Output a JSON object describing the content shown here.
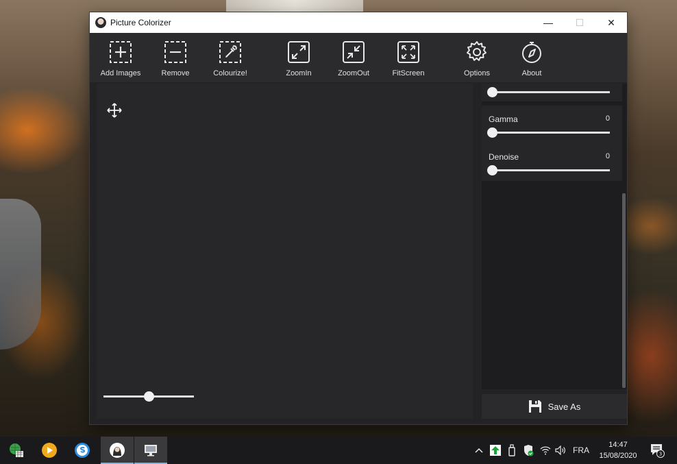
{
  "window": {
    "title": "Picture Colorizer",
    "controls": {
      "minimize": "—",
      "maximize": "☐",
      "close": "✕"
    }
  },
  "toolbar": {
    "add_images": "Add Images",
    "remove": "Remove",
    "colourize": "Colourize!",
    "zoom_in": "ZoomIn",
    "zoom_out": "ZoomOut",
    "fit_screen": "FitScreen",
    "options": "Options",
    "about": "About"
  },
  "canvas": {
    "zoom_level_fraction": 0.5
  },
  "panel": {
    "gamma_label": "Gamma",
    "gamma_value": "0",
    "denoise_label": "Denoise",
    "denoise_value": "0",
    "save_as": "Save As"
  },
  "taskbar": {
    "language": "FRA",
    "time": "14:47",
    "date": "15/08/2020",
    "notification_count": "3"
  },
  "colors": {
    "window_bg": "#232326",
    "toolbar_bg": "#2b2b2e",
    "panel_bg": "#1d1d1f",
    "taskbar_bg": "#1a1a1c",
    "accent": "#7fb3e8"
  }
}
